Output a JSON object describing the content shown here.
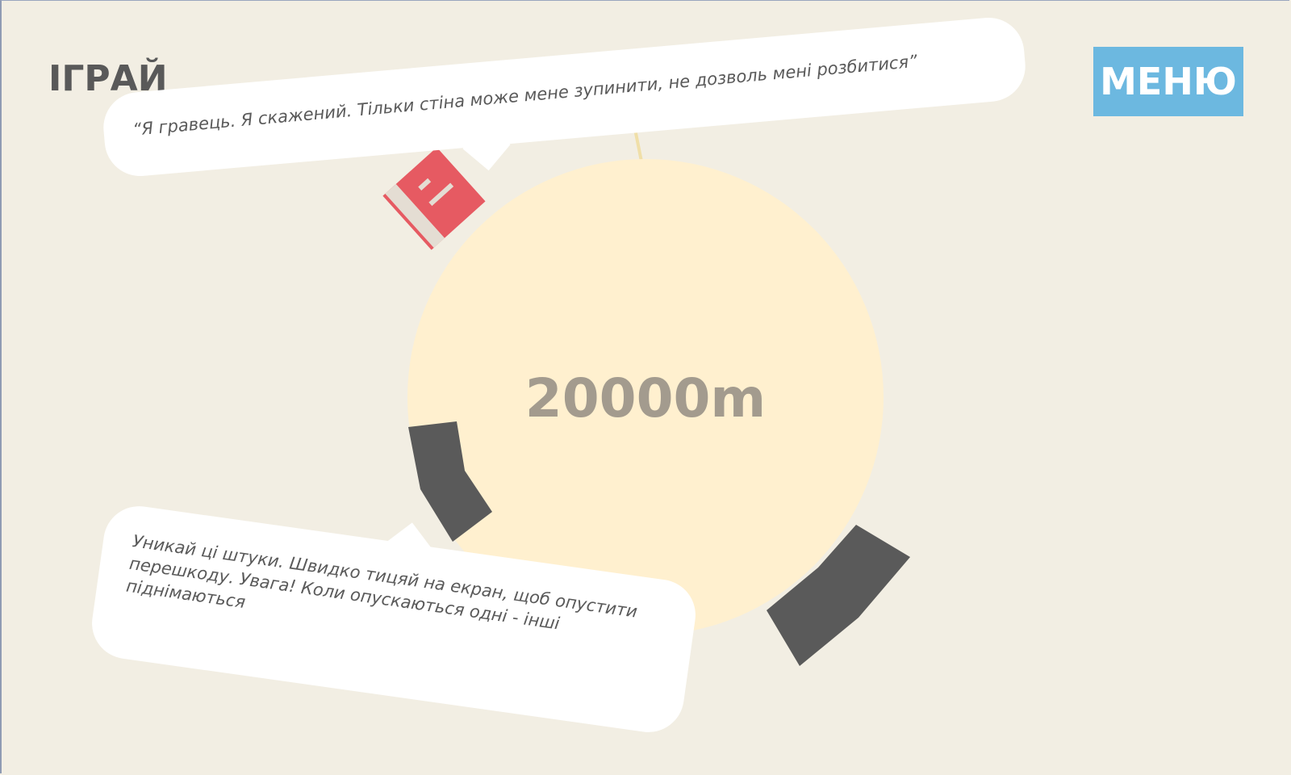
{
  "header": {
    "title": "ІГРАЙ",
    "menu_label": "МЕНЮ"
  },
  "game": {
    "distance": "20000m",
    "player_quote": "“Я гравець. Я скажений. Тільки стіна може мене зупинити, не дозволь мені розбитися”",
    "tutorial_tip": "Уникай ці штуки. Швидко тицяй на екран, щоб опустити перешкоду. Увага! Коли опускаються одні - інші піднімаються"
  },
  "colors": {
    "background": "#f2eee3",
    "planet": "#fff0cf",
    "obstacle": "#5a5a5a",
    "player": "#e65a62",
    "menu_button": "#6cb8e0",
    "title_text": "#595959",
    "distance_text": "#a39b8e"
  }
}
